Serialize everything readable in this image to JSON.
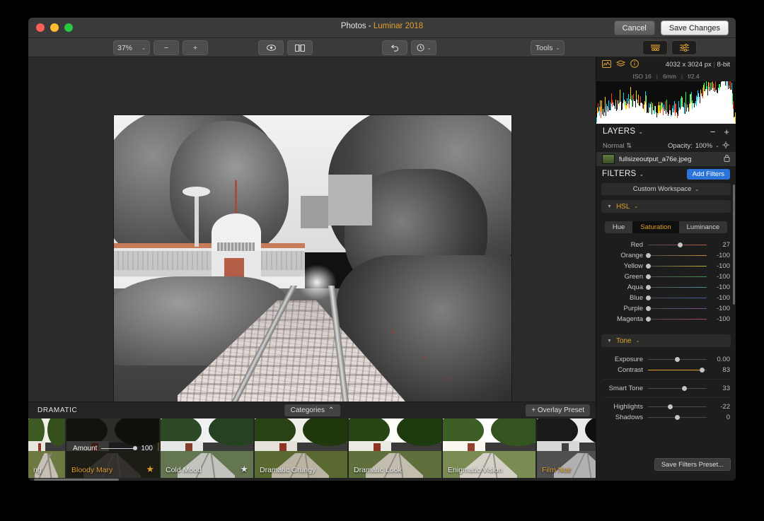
{
  "window": {
    "title_main": "Photos - ",
    "title_accent": "Luminar 2018",
    "cancel": "Cancel",
    "save_changes": "Save Changes"
  },
  "toolbar": {
    "zoom_level": "37%",
    "zoom_out": "−",
    "zoom_in": "+",
    "preview_icon": "eye-icon",
    "compare_icon": "split-compare-icon",
    "undo_icon": "undo-arrow-icon",
    "history_icon": "clock-history-icon",
    "tools": "Tools",
    "presets_toggle_icon": "presets-filmstrip-icon",
    "filters_toggle_icon": "sliders-icon",
    "chevron": "⌄"
  },
  "info_bar": {
    "histogram_icon": "histogram-icon",
    "layers_icon": "layers-stack-icon",
    "info_icon": "info-circle-icon",
    "dimensions": "4032 x 3024 px",
    "bit_depth": "8-bit",
    "separator": "|"
  },
  "exif": {
    "iso": "ISO 16",
    "focal": "6mm",
    "aperture": "f/2.4"
  },
  "layers": {
    "title": "LAYERS",
    "chevron": "⌄",
    "remove": "−",
    "add": "+",
    "blend_mode": "Normal",
    "blend_arrows": "⇅",
    "opacity_label": "Opacity:",
    "opacity_value": "100%",
    "gear_icon": "gear-icon",
    "layer_name": "fullsizeoutput_a76e.jpeg",
    "lock_icon": "lock-icon"
  },
  "filters": {
    "title": "FILTERS",
    "chevron": "⌄",
    "add_filters": "Add Filters",
    "workspace": "Custom Workspace",
    "save_preset": "Save Filters Preset..."
  },
  "hsl": {
    "name": "HSL",
    "tabs": [
      {
        "label": "Hue",
        "active": false
      },
      {
        "label": "Saturation",
        "active": true
      },
      {
        "label": "Luminance",
        "active": false
      }
    ],
    "sliders": [
      {
        "label": "Red",
        "value": "27",
        "pos": 55,
        "color": "#c1564a"
      },
      {
        "label": "Orange",
        "value": "-100",
        "pos": 0,
        "color": "#c08b3a"
      },
      {
        "label": "Yellow",
        "value": "-100",
        "pos": 0,
        "color": "#bfb23c"
      },
      {
        "label": "Green",
        "value": "-100",
        "pos": 0,
        "color": "#4f8f52"
      },
      {
        "label": "Aqua",
        "value": "-100",
        "pos": 0,
        "color": "#4a8f96"
      },
      {
        "label": "Blue",
        "value": "-100",
        "pos": 0,
        "color": "#3f5fa8"
      },
      {
        "label": "Purple",
        "value": "-100",
        "pos": 0,
        "color": "#7a5490"
      },
      {
        "label": "Magenta",
        "value": "-100",
        "pos": 0,
        "color": "#a8496e"
      }
    ]
  },
  "tone": {
    "name": "Tone",
    "sliders": [
      {
        "label": "Exposure",
        "value": "0.00",
        "pos": 50,
        "accent": false
      },
      {
        "label": "Contrast",
        "value": "83",
        "pos": 92,
        "accent": true
      },
      {
        "label": "Smart Tone",
        "value": "33",
        "pos": 62,
        "accent": false
      },
      {
        "label": "Highlights",
        "value": "-22",
        "pos": 38,
        "accent": false
      },
      {
        "label": "Shadows",
        "value": "0",
        "pos": 50,
        "accent": false
      }
    ]
  },
  "presets": {
    "category_title": "DRAMATIC",
    "categories_button": "Categories",
    "categories_chevron": "⌃",
    "overlay_button": "+ Overlay Preset",
    "items": [
      {
        "name": "ng",
        "partial": true,
        "selected": false,
        "starred": false,
        "style": "bright"
      },
      {
        "name": "Bloody Mary",
        "partial": false,
        "selected": true,
        "starred": true,
        "style": "dark",
        "amount_label": "Amount",
        "amount_value": "100"
      },
      {
        "name": "Cold Mood",
        "partial": false,
        "selected": false,
        "starred": true,
        "style": "cold"
      },
      {
        "name": "Dramatic Grungy",
        "partial": false,
        "selected": false,
        "starred": false,
        "style": "grungy"
      },
      {
        "name": "Dramatic Look",
        "partial": false,
        "selected": false,
        "starred": false,
        "style": "look"
      },
      {
        "name": "Enigmatic Vision",
        "partial": false,
        "selected": false,
        "starred": false,
        "style": "enigmatic"
      },
      {
        "name": "Film Noir",
        "partial": false,
        "selected": false,
        "starred": false,
        "style": "noir",
        "amber_label": true
      }
    ]
  },
  "colors": {
    "accent": "#e0a030",
    "blue_button": "#2b74d9",
    "panel_bg": "#1d1d1d",
    "canvas_bg": "#2b2b2b",
    "titlebar_bg": "#3a3a3a"
  }
}
